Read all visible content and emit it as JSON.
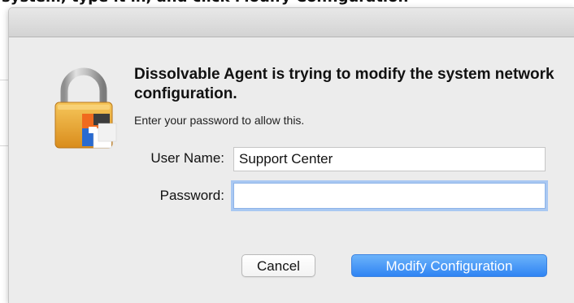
{
  "background": {
    "partial_text": "system, type it in, and click Modify Configuration"
  },
  "dialog": {
    "title_line": "Dissolvable Agent is trying to modify the system network configuration.",
    "subtitle": "Enter your password to allow this.",
    "username_label": "User Name:",
    "username_value": "Support Center",
    "password_label": "Password:",
    "password_value": "",
    "cancel_label": "Cancel",
    "confirm_label": "Modify Configuration"
  },
  "colors": {
    "primary_button": "#2f84f3",
    "focus_ring": "#a9c8f2",
    "dialog_bg": "#ececec"
  }
}
